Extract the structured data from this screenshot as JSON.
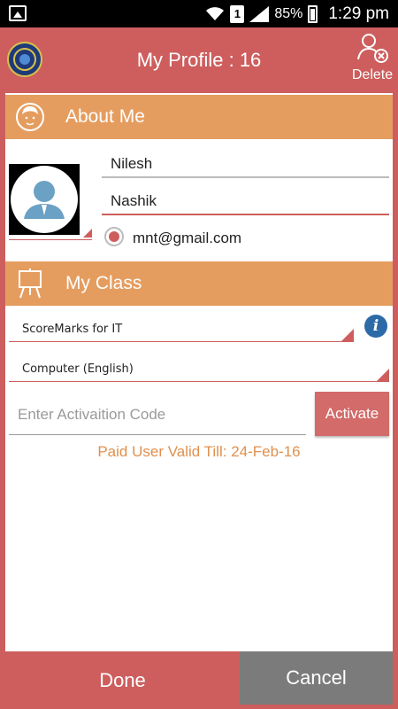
{
  "status_bar": {
    "battery": "85%",
    "sim": "1",
    "time": "1:29 pm"
  },
  "header": {
    "title": "My Profile : 16",
    "delete_label": "Delete"
  },
  "about_me": {
    "title": "About Me",
    "name": "Nilesh",
    "city": "Nashik",
    "email": "mnt@gmail.com"
  },
  "my_class": {
    "title": "My Class",
    "course": "ScoreMarks for IT",
    "subject": "Computer (English)",
    "activation_placeholder": "Enter Activaition Code",
    "activate_label": "Activate",
    "valid_till": "Paid User Valid Till: 24-Feb-16"
  },
  "footer": {
    "done_label": "Done",
    "cancel_label": "Cancel"
  },
  "colors": {
    "primary": "#cd5e5d",
    "section_header": "#e59d5f",
    "accent_text": "#e0904e",
    "cancel": "#7b7b7b"
  }
}
